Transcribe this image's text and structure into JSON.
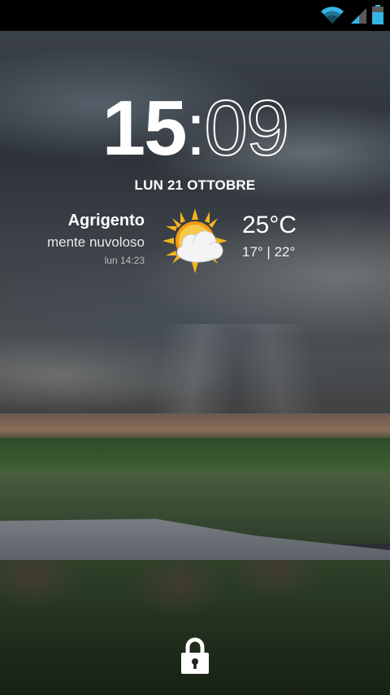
{
  "status_bar": {
    "icons": [
      "wifi-icon",
      "signal-icon",
      "battery-icon"
    ]
  },
  "clock": {
    "hours": "15",
    "separator": ":",
    "minutes": "09"
  },
  "date": "LUN 21 OTTOBRE",
  "weather": {
    "city": "Agrigento",
    "condition": "mente nuvoloso",
    "updated": "lun 14:23",
    "temperature": "25°C",
    "range": "17° | 22°",
    "icon": "partly-cloudy-sun-icon"
  },
  "lock": {
    "icon": "padlock-icon"
  },
  "colors": {
    "wifi": "#33b5e5",
    "battery": "#33b5e5",
    "sun": "#f5b41e",
    "cloud": "#f4f4f4"
  }
}
